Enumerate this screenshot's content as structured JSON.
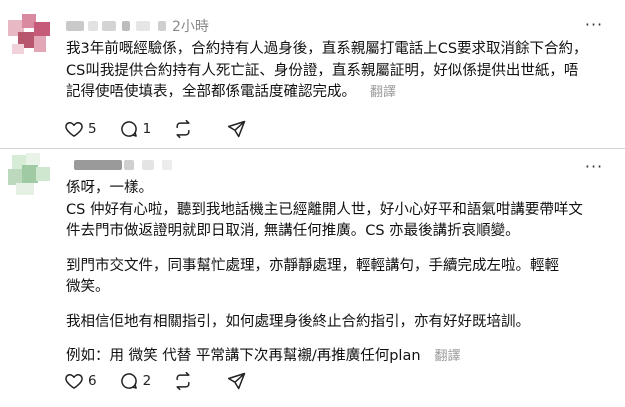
{
  "posts": [
    {
      "timestamp": "2小時",
      "paragraphs": [
        [
          "我3年前嘅經驗係，合約持有人過身後，直系親屬打電話上CS要求取消餘下合約，",
          "CS叫我提供合約持有人死亡証、身份證，直系親屬証明，好似係提供出世紙，唔",
          "記得使唔使填表，全部都係電話度確認完成。"
        ]
      ],
      "translate_label": "翻譯",
      "likes": "5",
      "comments": "1",
      "reposts": "",
      "shares": ""
    },
    {
      "timestamp": "",
      "paragraphs": [
        [
          "係呀，一樣。"
        ],
        [
          "CS 仲好有心啦，聽到我地話機主已經離開人世，好小心好平和語氣咁講要帶咩文",
          "件去門市做返證明就即日取消, 無講任何推廣。CS 亦最後講折哀順變。"
        ],
        [
          "到門市交文件，同事幫忙處理，亦靜靜處理，輕輕講句，手續完成左啦。輕輕",
          "微笑。"
        ],
        [
          "我相信佢地有相關指引，如何處理身後終止合約指引，亦有好好既培訓。"
        ],
        [
          "例如：用 微笑 代替 平常講下次再幫襯/再推廣任何plan"
        ]
      ],
      "translate_label": "翻譯",
      "likes": "6",
      "comments": "2",
      "reposts": "",
      "shares": ""
    }
  ],
  "icons": {
    "more": "more-horizontal-icon",
    "like": "heart-icon",
    "comment": "comment-icon",
    "repost": "repost-icon",
    "share": "share-icon"
  },
  "colors": {
    "text": "#111111",
    "muted": "#8a8a8a",
    "translate": "#999999",
    "divider": "#d6d6d6"
  }
}
